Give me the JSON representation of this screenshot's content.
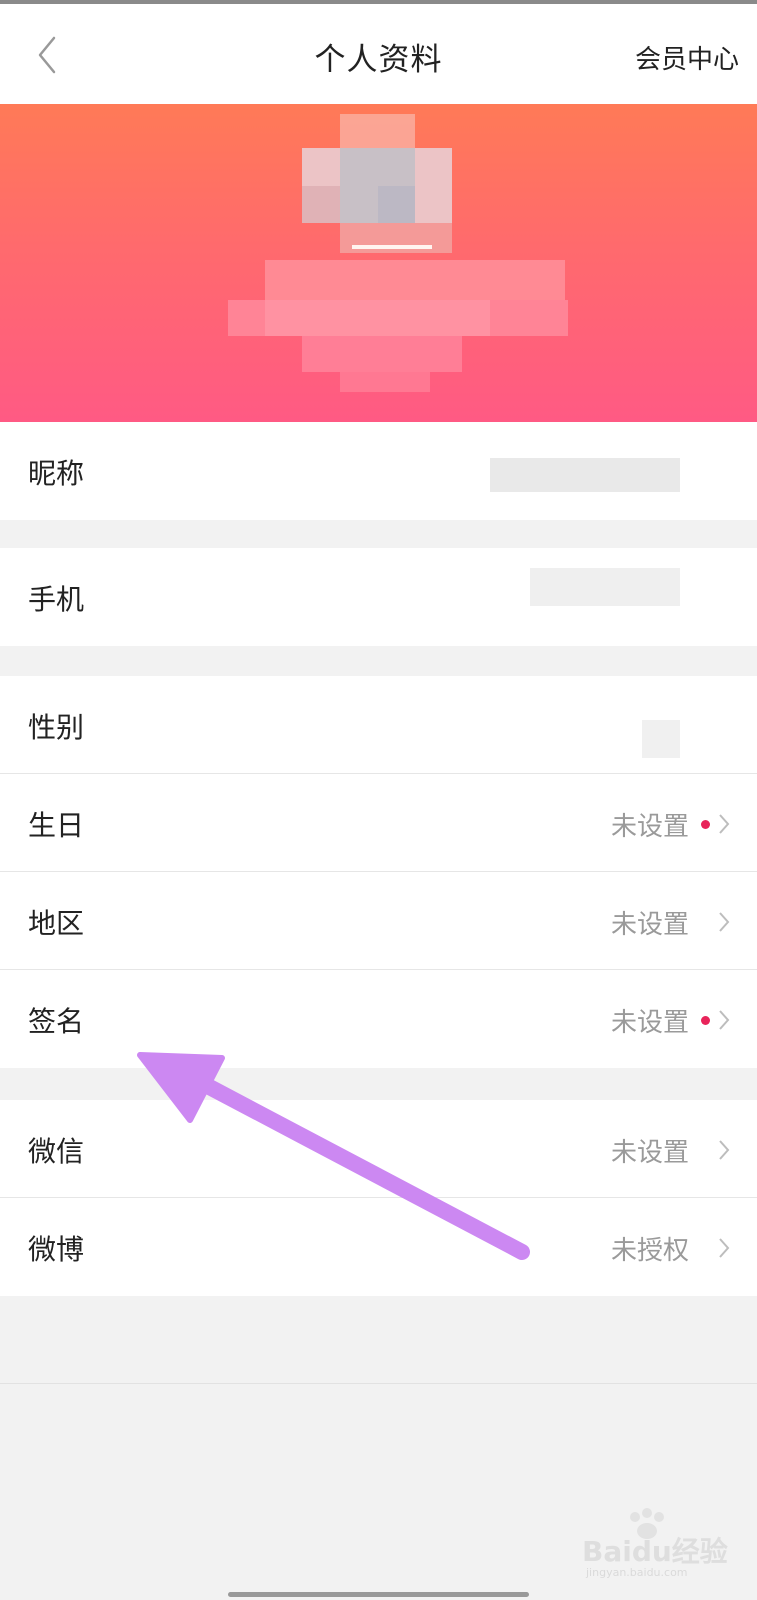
{
  "header": {
    "title": "个人资料",
    "right_link": "会员中心"
  },
  "fields": {
    "nickname": {
      "label": "昵称"
    },
    "phone": {
      "label": "手机"
    },
    "gender": {
      "label": "性别"
    },
    "birthday": {
      "label": "生日",
      "value": "未设置"
    },
    "region": {
      "label": "地区",
      "value": "未设置"
    },
    "signature": {
      "label": "签名",
      "value": "未设置"
    },
    "wechat": {
      "label": "微信",
      "value": "未设置"
    },
    "weibo": {
      "label": "微博",
      "value": "未授权"
    }
  },
  "watermark": {
    "text": "Baidu经验",
    "sub": "jingyan.baidu.com"
  },
  "colors": {
    "banner_top": "#ff7a57",
    "banner_bottom": "#ff5a84",
    "dot": "#e8245a",
    "arrow": "#cc88f2"
  },
  "icons": [
    "back-icon",
    "chevron-right-icon",
    "new-dot-icon",
    "annotation-arrow"
  ]
}
